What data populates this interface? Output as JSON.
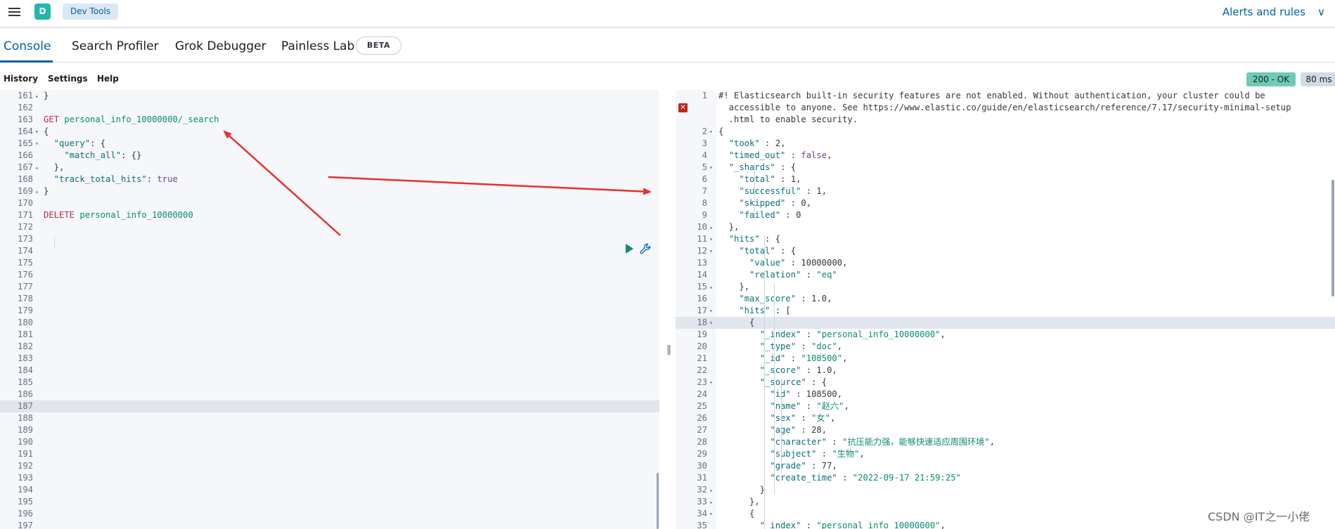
{
  "header": {
    "space_initial": "D",
    "breadcrumb": "Dev Tools",
    "alerts_label": "Alerts and rules",
    "alerts_chevron": "∨"
  },
  "tabs": [
    {
      "label": "Console"
    },
    {
      "label": "Search Profiler"
    },
    {
      "label": "Grok Debugger"
    },
    {
      "label": "Painless Lab"
    }
  ],
  "beta_badge": "BETA",
  "toolbar": {
    "history": "History",
    "settings": "Settings",
    "help": "Help",
    "status": "200 - OK",
    "time": "80 ms"
  },
  "request_editor": {
    "lines": [
      {
        "n": "161",
        "fold": "up",
        "segs": [
          [
            "p",
            "}"
          ]
        ]
      },
      {
        "n": "162",
        "segs": []
      },
      {
        "n": "163",
        "segs": [
          [
            "method",
            "GET "
          ],
          [
            "url",
            "personal_info_10000000/_search"
          ]
        ]
      },
      {
        "n": "164",
        "fold": "down",
        "segs": [
          [
            "p",
            "{"
          ]
        ]
      },
      {
        "n": "165",
        "fold": "down",
        "segs": [
          [
            "p",
            "  "
          ],
          [
            "key",
            "\"query\""
          ],
          [
            "p",
            ": {"
          ]
        ]
      },
      {
        "n": "166",
        "segs": [
          [
            "p",
            "    "
          ],
          [
            "key",
            "\"match_all\""
          ],
          [
            "p",
            ": {}"
          ]
        ]
      },
      {
        "n": "167",
        "fold": "up",
        "segs": [
          [
            "p",
            "  },"
          ]
        ]
      },
      {
        "n": "168",
        "segs": [
          [
            "p",
            "  "
          ],
          [
            "key",
            "\"track_total_hits\""
          ],
          [
            "p",
            ": "
          ],
          [
            "bool",
            "true"
          ]
        ]
      },
      {
        "n": "169",
        "fold": "up",
        "segs": [
          [
            "p",
            "}"
          ]
        ]
      },
      {
        "n": "170",
        "segs": []
      },
      {
        "n": "171",
        "segs": [
          [
            "method",
            "DELETE "
          ],
          [
            "url",
            "personal_info_10000000"
          ]
        ]
      },
      {
        "n": "172",
        "segs": []
      },
      {
        "n": "173",
        "segs": []
      },
      {
        "n": "174",
        "segs": []
      },
      {
        "n": "175",
        "segs": []
      },
      {
        "n": "176",
        "segs": []
      },
      {
        "n": "177",
        "segs": []
      },
      {
        "n": "178",
        "segs": []
      },
      {
        "n": "179",
        "segs": []
      },
      {
        "n": "180",
        "segs": []
      },
      {
        "n": "181",
        "segs": []
      },
      {
        "n": "182",
        "segs": []
      },
      {
        "n": "183",
        "segs": []
      },
      {
        "n": "184",
        "segs": []
      },
      {
        "n": "185",
        "segs": []
      },
      {
        "n": "186",
        "segs": []
      },
      {
        "n": "187",
        "segs": [],
        "active": true
      },
      {
        "n": "188",
        "segs": []
      },
      {
        "n": "189",
        "segs": []
      },
      {
        "n": "190",
        "segs": []
      },
      {
        "n": "191",
        "segs": []
      },
      {
        "n": "192",
        "segs": []
      },
      {
        "n": "193",
        "segs": []
      },
      {
        "n": "194",
        "segs": []
      },
      {
        "n": "195",
        "segs": []
      },
      {
        "n": "196",
        "segs": []
      },
      {
        "n": "197",
        "segs": []
      }
    ]
  },
  "response_editor": {
    "lines": [
      {
        "n": "1",
        "segs": [
          [
            "p",
            "#! Elasticsearch built-in security features are not enabled. Without authentication, your cluster could be"
          ]
        ]
      },
      {
        "n": "",
        "segs": [
          [
            "p",
            "  accessible to anyone. See https://www.elastic.co/guide/en/elasticsearch/reference/7.17/security-minimal-setup"
          ]
        ]
      },
      {
        "n": "",
        "segs": [
          [
            "p",
            "  .html to enable security."
          ]
        ]
      },
      {
        "n": "2",
        "fold": "down",
        "segs": [
          [
            "p",
            "{"
          ]
        ]
      },
      {
        "n": "3",
        "segs": [
          [
            "p",
            "  "
          ],
          [
            "key",
            "\"took\""
          ],
          [
            "p",
            " : 2,"
          ]
        ]
      },
      {
        "n": "4",
        "segs": [
          [
            "p",
            "  "
          ],
          [
            "key",
            "\"timed_out\""
          ],
          [
            "p",
            " : "
          ],
          [
            "bool",
            "false"
          ],
          [
            "p",
            ","
          ]
        ]
      },
      {
        "n": "5",
        "fold": "down",
        "segs": [
          [
            "p",
            "  "
          ],
          [
            "key",
            "\"_shards\""
          ],
          [
            "p",
            " : {"
          ]
        ]
      },
      {
        "n": "6",
        "segs": [
          [
            "p",
            "    "
          ],
          [
            "key",
            "\"total\""
          ],
          [
            "p",
            " : 1,"
          ]
        ]
      },
      {
        "n": "7",
        "segs": [
          [
            "p",
            "    "
          ],
          [
            "key",
            "\"successful\""
          ],
          [
            "p",
            " : 1,"
          ]
        ]
      },
      {
        "n": "8",
        "segs": [
          [
            "p",
            "    "
          ],
          [
            "key",
            "\"skipped\""
          ],
          [
            "p",
            " : 0,"
          ]
        ]
      },
      {
        "n": "9",
        "segs": [
          [
            "p",
            "    "
          ],
          [
            "key",
            "\"failed\""
          ],
          [
            "p",
            " : 0"
          ]
        ]
      },
      {
        "n": "10",
        "fold": "up",
        "segs": [
          [
            "p",
            "  },"
          ]
        ]
      },
      {
        "n": "11",
        "fold": "down",
        "segs": [
          [
            "p",
            "  "
          ],
          [
            "key",
            "\"hits\""
          ],
          [
            "p",
            " : {"
          ]
        ]
      },
      {
        "n": "12",
        "fold": "down",
        "segs": [
          [
            "p",
            "    "
          ],
          [
            "key",
            "\"total\""
          ],
          [
            "p",
            " : {"
          ]
        ]
      },
      {
        "n": "13",
        "segs": [
          [
            "p",
            "      "
          ],
          [
            "key",
            "\"value\""
          ],
          [
            "p",
            " : 10000000,"
          ]
        ]
      },
      {
        "n": "14",
        "segs": [
          [
            "p",
            "      "
          ],
          [
            "key",
            "\"relation\""
          ],
          [
            "p",
            " : "
          ],
          [
            "str",
            "\"eq\""
          ]
        ]
      },
      {
        "n": "15",
        "fold": "up",
        "segs": [
          [
            "p",
            "    },"
          ]
        ]
      },
      {
        "n": "16",
        "segs": [
          [
            "p",
            "    "
          ],
          [
            "key",
            "\"max_score\""
          ],
          [
            "p",
            " : 1.0,"
          ]
        ]
      },
      {
        "n": "17",
        "fold": "down",
        "segs": [
          [
            "p",
            "    "
          ],
          [
            "key",
            "\"hits\""
          ],
          [
            "p",
            " : ["
          ]
        ]
      },
      {
        "n": "18",
        "fold": "down",
        "active": true,
        "segs": [
          [
            "p",
            "      {"
          ]
        ]
      },
      {
        "n": "19",
        "segs": [
          [
            "p",
            "        "
          ],
          [
            "key",
            "\"_index\""
          ],
          [
            "p",
            " : "
          ],
          [
            "str",
            "\"personal_info_10000000\""
          ],
          [
            "p",
            ","
          ]
        ]
      },
      {
        "n": "20",
        "segs": [
          [
            "p",
            "        "
          ],
          [
            "key",
            "\"_type\""
          ],
          [
            "p",
            " : "
          ],
          [
            "str",
            "\"doc\""
          ],
          [
            "p",
            ","
          ]
        ]
      },
      {
        "n": "21",
        "segs": [
          [
            "p",
            "        "
          ],
          [
            "key",
            "\"_id\""
          ],
          [
            "p",
            " : "
          ],
          [
            "str",
            "\"108500\""
          ],
          [
            "p",
            ","
          ]
        ]
      },
      {
        "n": "22",
        "segs": [
          [
            "p",
            "        "
          ],
          [
            "key",
            "\"_score\""
          ],
          [
            "p",
            " : 1.0,"
          ]
        ]
      },
      {
        "n": "23",
        "fold": "down",
        "segs": [
          [
            "p",
            "        "
          ],
          [
            "key",
            "\"_source\""
          ],
          [
            "p",
            " : {"
          ]
        ]
      },
      {
        "n": "24",
        "segs": [
          [
            "p",
            "          "
          ],
          [
            "key",
            "\"id\""
          ],
          [
            "p",
            " : 108500,"
          ]
        ]
      },
      {
        "n": "25",
        "segs": [
          [
            "p",
            "          "
          ],
          [
            "key",
            "\"name\""
          ],
          [
            "p",
            " : "
          ],
          [
            "str",
            "\"赵六\""
          ],
          [
            "p",
            ","
          ]
        ]
      },
      {
        "n": "26",
        "segs": [
          [
            "p",
            "          "
          ],
          [
            "key",
            "\"sex\""
          ],
          [
            "p",
            " : "
          ],
          [
            "str",
            "\"女\""
          ],
          [
            "p",
            ","
          ]
        ]
      },
      {
        "n": "27",
        "segs": [
          [
            "p",
            "          "
          ],
          [
            "key",
            "\"age\""
          ],
          [
            "p",
            " : 28,"
          ]
        ]
      },
      {
        "n": "28",
        "segs": [
          [
            "p",
            "          "
          ],
          [
            "key",
            "\"character\""
          ],
          [
            "p",
            " : "
          ],
          [
            "str",
            "\"抗压能力强，能够快速适应周围环境\""
          ],
          [
            "p",
            ","
          ]
        ]
      },
      {
        "n": "29",
        "segs": [
          [
            "p",
            "          "
          ],
          [
            "key",
            "\"subject\""
          ],
          [
            "p",
            " : "
          ],
          [
            "str",
            "\"生物\""
          ],
          [
            "p",
            ","
          ]
        ]
      },
      {
        "n": "30",
        "segs": [
          [
            "p",
            "          "
          ],
          [
            "key",
            "\"grade\""
          ],
          [
            "p",
            " : 77,"
          ]
        ]
      },
      {
        "n": "31",
        "segs": [
          [
            "p",
            "          "
          ],
          [
            "key",
            "\"create_time\""
          ],
          [
            "p",
            " : "
          ],
          [
            "str",
            "\"2022-09-17 21:59:25\""
          ]
        ]
      },
      {
        "n": "32",
        "fold": "up",
        "segs": [
          [
            "p",
            "        }"
          ]
        ]
      },
      {
        "n": "33",
        "fold": "up",
        "segs": [
          [
            "p",
            "      },"
          ]
        ]
      },
      {
        "n": "34",
        "fold": "down",
        "segs": [
          [
            "p",
            "      {"
          ]
        ]
      },
      {
        "n": "35",
        "segs": [
          [
            "p",
            "        "
          ],
          [
            "key",
            "\"_index\""
          ],
          [
            "p",
            " : "
          ],
          [
            "str",
            "\"personal_info_10000000\""
          ],
          [
            "p",
            ","
          ]
        ]
      }
    ]
  },
  "watermark": "CSDN @IT之一小佬",
  "colors": {
    "accent": "#0061a6",
    "status_ok": "#6dccb1",
    "annotation_arrow": "#e8302d"
  }
}
